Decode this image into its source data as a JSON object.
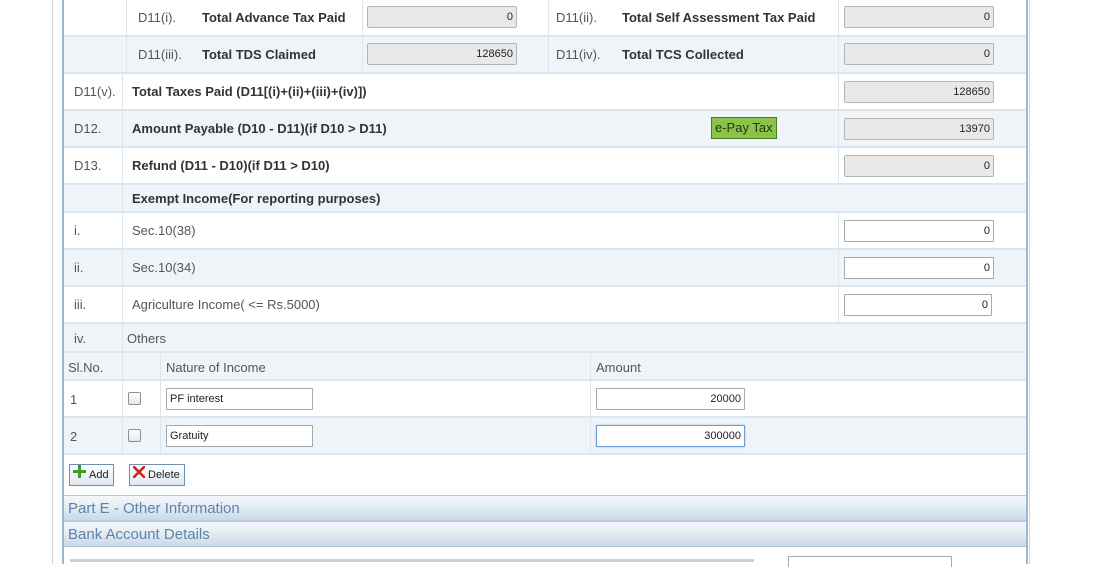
{
  "tax_paid": {
    "d11i": {
      "code": "D11(i).",
      "label": "Total Advance Tax Paid",
      "value": "0"
    },
    "d11ii": {
      "code": "D11(ii).",
      "label": "Total Self Assessment Tax Paid",
      "value": "0"
    },
    "d11iii": {
      "code": "D11(iii).",
      "label": "Total TDS Claimed",
      "value": "128650"
    },
    "d11iv": {
      "code": "D11(iv).",
      "label": "Total TCS Collected",
      "value": "0"
    },
    "d11v": {
      "code": "D11(v).",
      "label": "Total Taxes Paid (D11[(i)+(ii)+(iii)+(iv)])",
      "value": "128650"
    },
    "d12": {
      "code": "D12.",
      "label": "Amount Payable (D10 - D11)(if D10 > D11)",
      "value": "13970",
      "button": "e-Pay Tax"
    },
    "d13": {
      "code": "D13.",
      "label": "Refund (D11 - D10)(if D11 > D10)",
      "value": "0"
    }
  },
  "exempt": {
    "heading": "Exempt Income(For reporting purposes)",
    "rows": [
      {
        "num": "i.",
        "label": "Sec.10(38)",
        "value": "0"
      },
      {
        "num": "ii.",
        "label": "Sec.10(34)",
        "value": "0"
      },
      {
        "num": "iii.",
        "label": "Agriculture Income( <= Rs.5000)",
        "value": "0"
      }
    ],
    "others": {
      "num": "iv.",
      "label": "Others"
    }
  },
  "others_table": {
    "headers": {
      "slno": "Sl.No.",
      "nature": "Nature of Income",
      "amount": "Amount"
    },
    "rows": [
      {
        "slno": "1",
        "nature": "PF interest",
        "amount": "20000"
      },
      {
        "slno": "2",
        "nature": "Gratuity",
        "amount": "300000"
      }
    ],
    "add_label": "Add",
    "delete_label": "Delete"
  },
  "sections": {
    "part_e": "Part E - Other Information",
    "bank": "Bank Account Details"
  }
}
